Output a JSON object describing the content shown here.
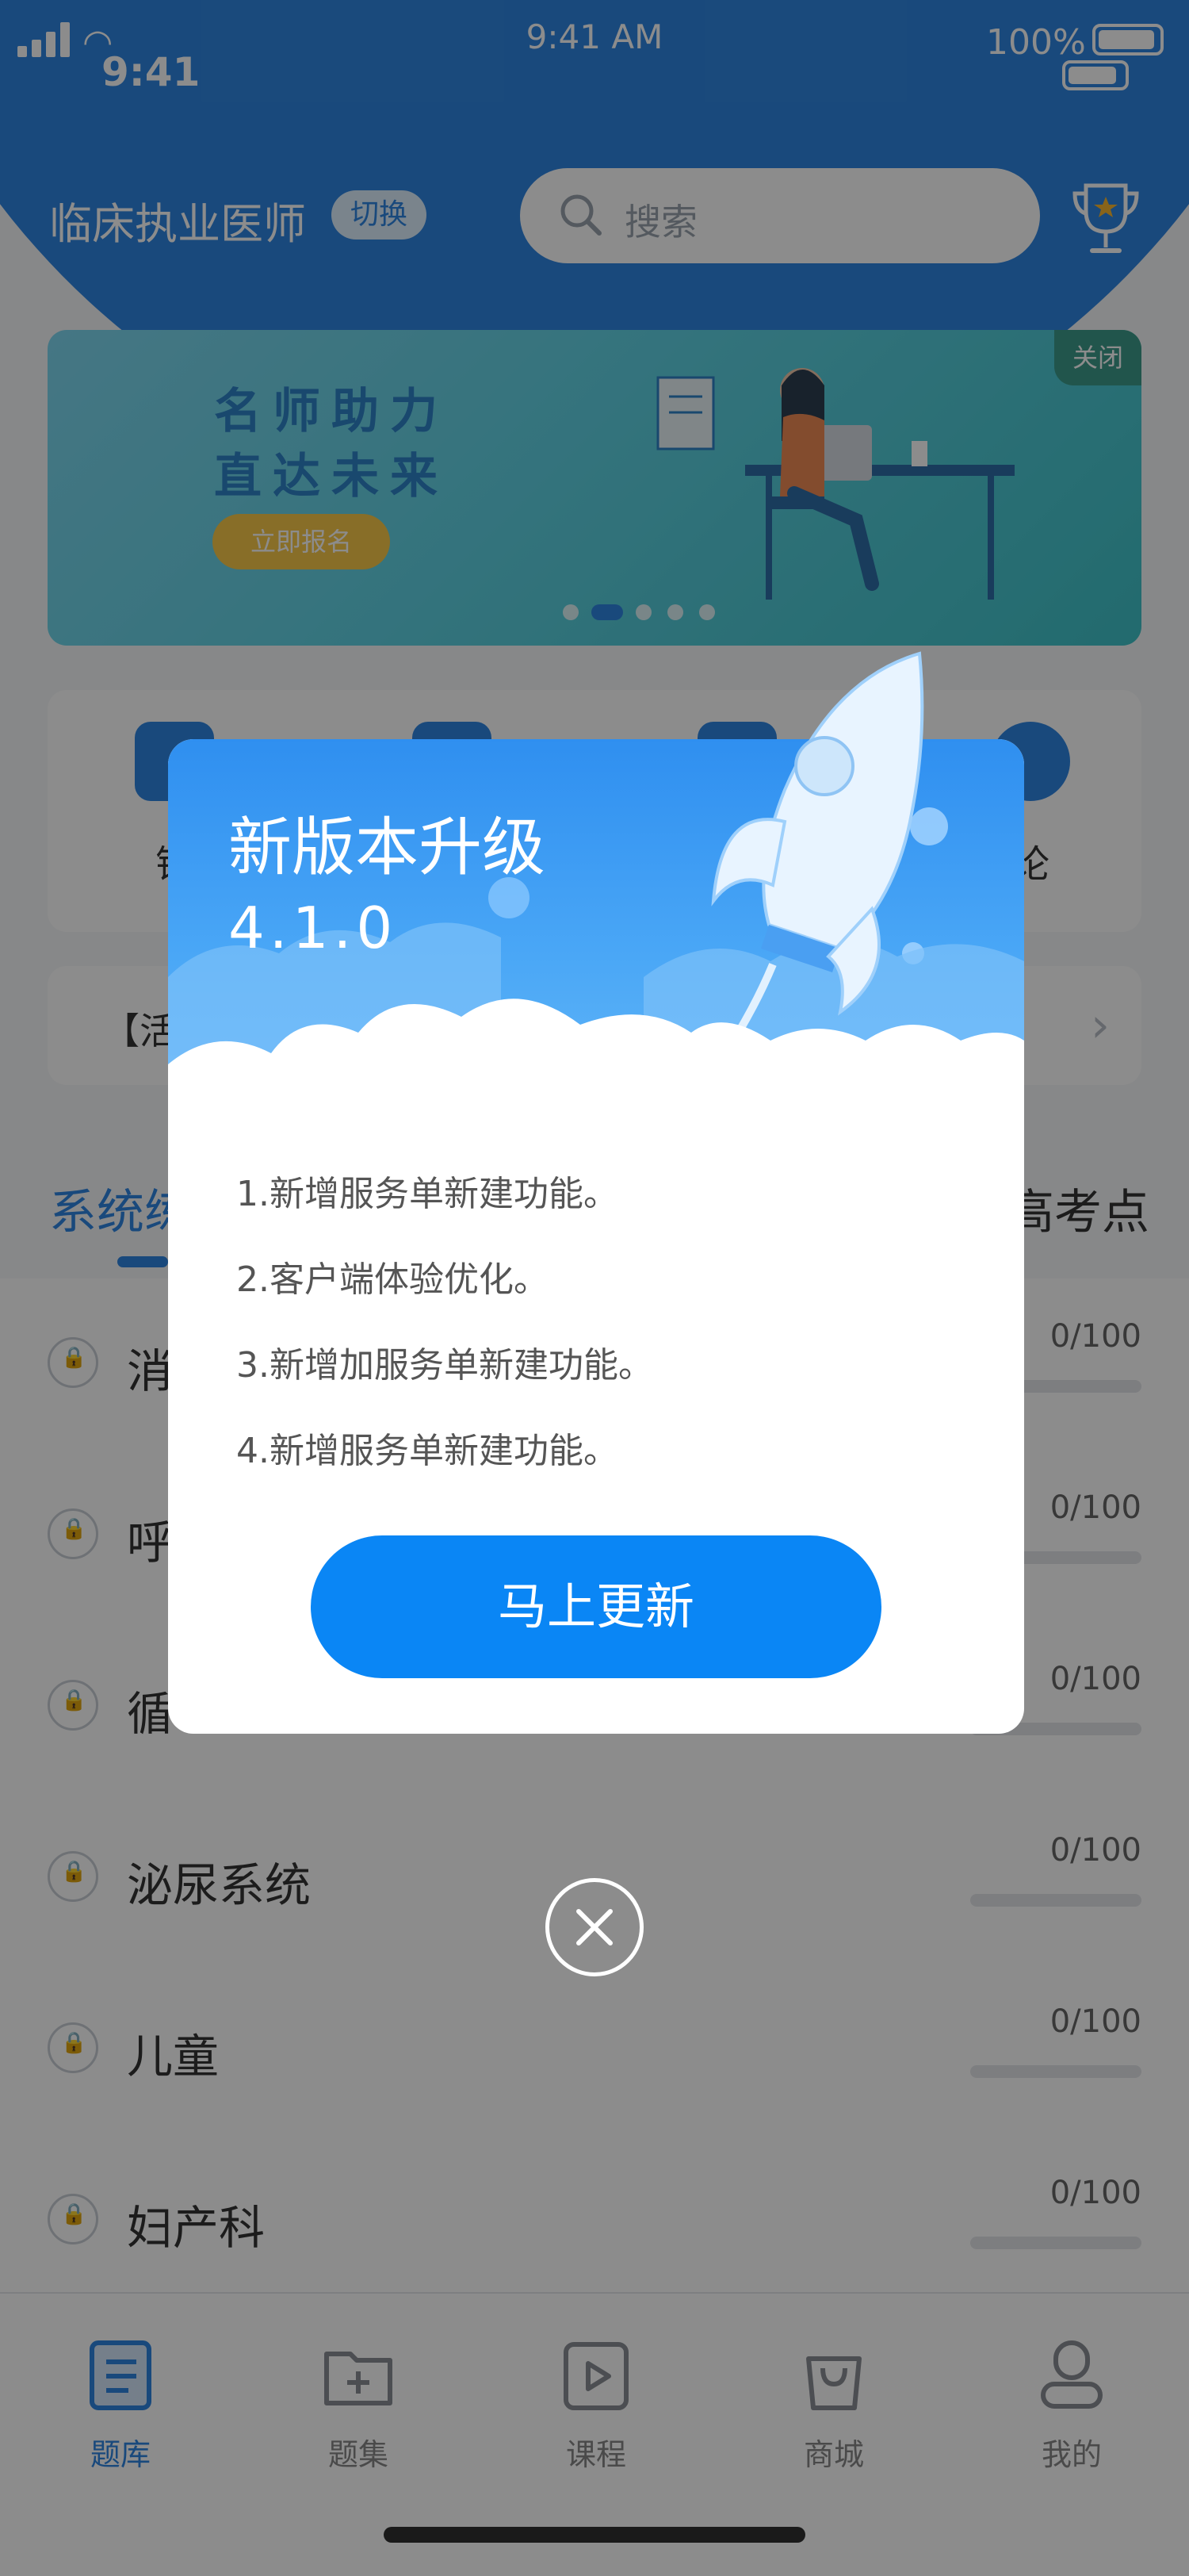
{
  "status_bar": {
    "time_left": "9:41",
    "time_center": "9:41 AM",
    "battery_percent": "100%"
  },
  "header": {
    "exam_title": "临床执业医师",
    "switch_label": "切换",
    "search_placeholder": "搜索"
  },
  "banner": {
    "line1": "名师助力",
    "line2": "直达未来",
    "button": "立即报名",
    "close": "关闭",
    "slide_count": 5,
    "active_slide": 2
  },
  "quick_actions": [
    {
      "label": "错"
    },
    {
      "label": ""
    },
    {
      "label": ""
    },
    {
      "label": "论"
    }
  ],
  "notice": {
    "text": "【活"
  },
  "tabs": {
    "left": "系统练",
    "right": "高考点"
  },
  "list": [
    {
      "name": "消",
      "count": "0/100",
      "progress": 0
    },
    {
      "name": "呼",
      "count": "0/100",
      "progress": 0
    },
    {
      "name": "循",
      "count": "0/100",
      "progress": 0
    },
    {
      "name": "泌尿系统",
      "count": "0/100",
      "progress": 0
    },
    {
      "name": "儿童",
      "count": "0/100",
      "progress": 0
    },
    {
      "name": "妇产科",
      "count": "0/100",
      "progress": 0
    }
  ],
  "tabbar": [
    {
      "label": "题库",
      "icon": "question-bank-icon",
      "active": true
    },
    {
      "label": "题集",
      "icon": "folder-plus-icon",
      "active": false
    },
    {
      "label": "课程",
      "icon": "play-icon",
      "active": false
    },
    {
      "label": "商城",
      "icon": "shopping-bag-icon",
      "active": false
    },
    {
      "label": "我的",
      "icon": "user-icon",
      "active": false
    }
  ],
  "update_modal": {
    "title": "新版本升级",
    "version": "4.1.0",
    "notes": [
      "1.新增服务单新建功能。",
      "2.客户端体验优化。",
      "3.新增加服务单新建功能。",
      "4.新增服务单新建功能。"
    ],
    "button": "马上更新"
  },
  "colors": {
    "primary": "#2f86e2",
    "button_blue": "#0a86f5",
    "overlay": "rgba(0,0,0,0.45)"
  }
}
